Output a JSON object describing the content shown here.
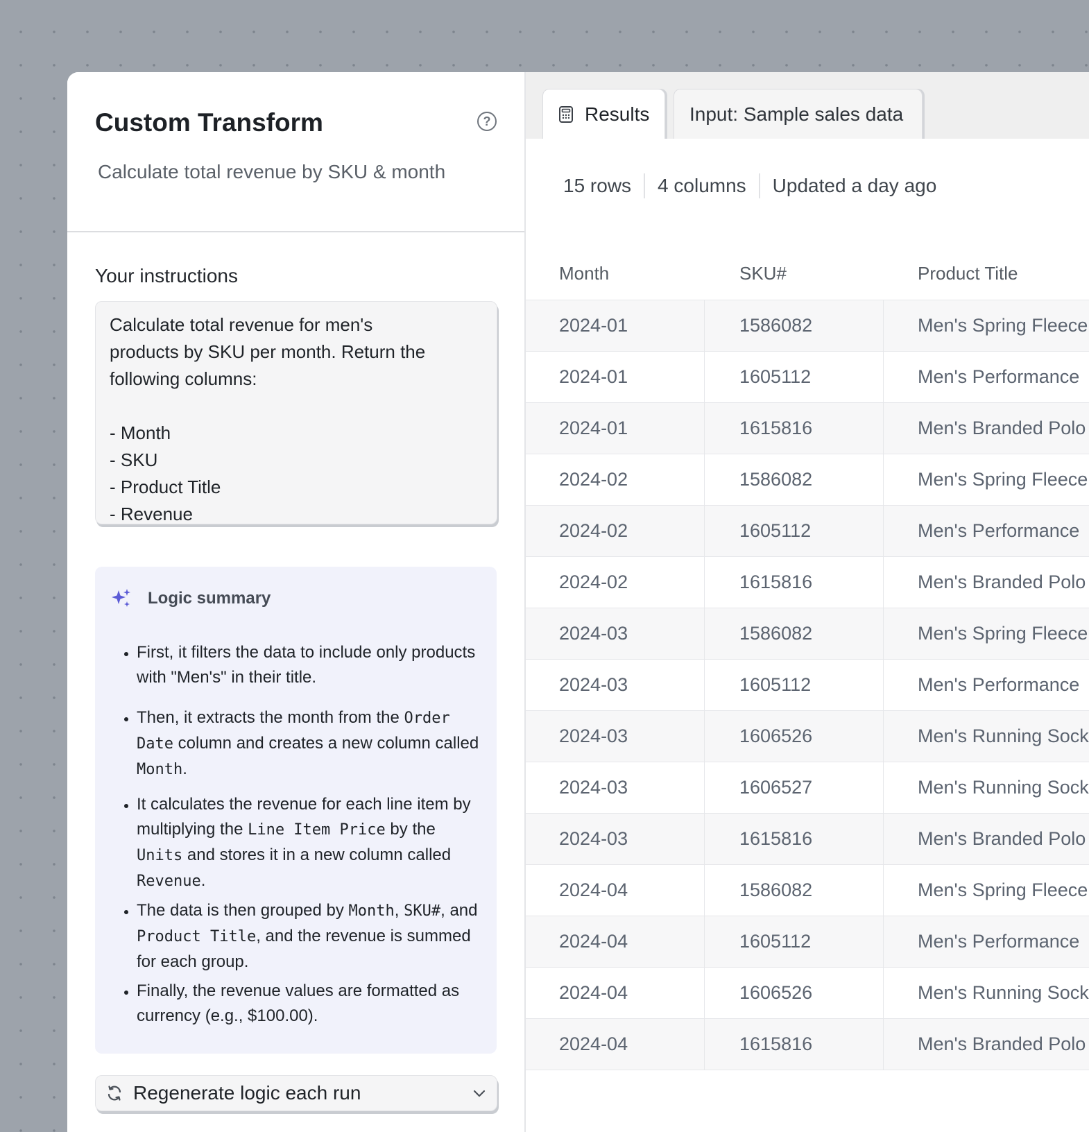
{
  "panel": {
    "title": "Custom Transform",
    "subtitle": "Calculate total revenue by SKU & month",
    "help_icon": "help-circle-icon"
  },
  "instructions": {
    "label": "Your instructions",
    "lines": [
      "Calculate total revenue for men's",
      "products by SKU per month. Return the",
      "following columns:",
      "",
      "- Month",
      "- SKU",
      "- Product Title",
      "- Revenue"
    ]
  },
  "logic": {
    "title": "Logic summary",
    "icon": "sparkle-icon",
    "items": [
      [
        {
          "t": "First, it filters the data to include only products with \"Men's\" in their title."
        }
      ],
      [
        {
          "t": "Then, it extracts the month from the "
        },
        {
          "code": "Order Date"
        },
        {
          "t": " column and creates a new column called "
        },
        {
          "code": "Month"
        },
        {
          "t": "."
        }
      ],
      [
        {
          "t": "It calculates the revenue for each line item by multiplying the "
        },
        {
          "code": "Line Item Price"
        },
        {
          "t": " by the "
        },
        {
          "code": "Units"
        },
        {
          "t": " and stores it in a new column called "
        },
        {
          "code": "Revenue"
        },
        {
          "t": "."
        }
      ],
      [
        {
          "t": "The data is then grouped by "
        },
        {
          "code": "Month"
        },
        {
          "t": ", "
        },
        {
          "code": "SKU#"
        },
        {
          "t": ", and "
        },
        {
          "code": "Product Title"
        },
        {
          "t": ", and the revenue is summed for each group."
        }
      ],
      [
        {
          "t": "Finally, the revenue values are formatted as currency (e.g., $100.00)."
        }
      ]
    ]
  },
  "regen": {
    "label": "Regenerate logic each run",
    "icon": "refresh-icon"
  },
  "tabs": {
    "results": "Results",
    "input": "Input: Sample sales data",
    "results_icon": "calculator-icon"
  },
  "meta": {
    "rows": "15 rows",
    "columns": "4 columns",
    "updated": "Updated a day ago"
  },
  "table": {
    "headers": [
      "Month",
      "SKU#",
      "Product Title"
    ],
    "rows": [
      [
        "2024-01",
        "1586082",
        "Men's Spring Fleece"
      ],
      [
        "2024-01",
        "1605112",
        "Men's Performance"
      ],
      [
        "2024-01",
        "1615816",
        "Men's Branded Polo"
      ],
      [
        "2024-02",
        "1586082",
        "Men's Spring Fleece"
      ],
      [
        "2024-02",
        "1605112",
        "Men's Performance"
      ],
      [
        "2024-02",
        "1615816",
        "Men's Branded Polo"
      ],
      [
        "2024-03",
        "1586082",
        "Men's Spring Fleece"
      ],
      [
        "2024-03",
        "1605112",
        "Men's Performance"
      ],
      [
        "2024-03",
        "1606526",
        "Men's Running Sock"
      ],
      [
        "2024-03",
        "1606527",
        "Men's Running Sock"
      ],
      [
        "2024-03",
        "1615816",
        "Men's Branded Polo"
      ],
      [
        "2024-04",
        "1586082",
        "Men's Spring Fleece"
      ],
      [
        "2024-04",
        "1605112",
        "Men's Performance"
      ],
      [
        "2024-04",
        "1606526",
        "Men's Running Sock"
      ],
      [
        "2024-04",
        "1615816",
        "Men's Branded Polo"
      ]
    ]
  },
  "colors": {
    "accent": "#5b5bd6",
    "logic_bg": "#f1f2fb",
    "canvas": "#9da3ab"
  }
}
